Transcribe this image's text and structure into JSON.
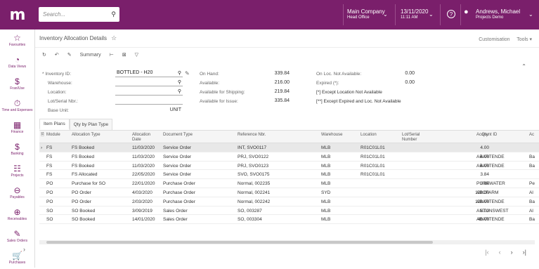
{
  "topbar": {
    "logo": "m",
    "search_placeholder": "Search...",
    "company": "Main Company",
    "branch": "Head Office",
    "date": "13/11/2020",
    "time": "11:11 AM",
    "help": "?",
    "user_name": "Andrews, Michael",
    "user_sub": "Projects Demo"
  },
  "sidebar": {
    "items": [
      {
        "icon": "☆",
        "label": "Favourites"
      },
      {
        "icon": "◔",
        "label": "Data Views"
      },
      {
        "icon": "$",
        "label": "Fran/Use"
      },
      {
        "icon": "⏱",
        "label": "Time and Expenses"
      },
      {
        "icon": "▦",
        "label": "Finance"
      },
      {
        "icon": "$",
        "label": "Banking"
      },
      {
        "icon": "☷",
        "label": "Projects"
      },
      {
        "icon": "⊖",
        "label": "Payables"
      },
      {
        "icon": "⊕",
        "label": "Receivables"
      },
      {
        "icon": "✎",
        "label": "Sales Orders"
      },
      {
        "icon": "🛒",
        "label": "Purchases"
      }
    ],
    "collapse": "›"
  },
  "page": {
    "title": "Inventory Allocation Details",
    "customisation": "Customisation",
    "tools": "Tools ▾",
    "summary": "Summary"
  },
  "form": {
    "inventory_id_label": "* Inventory ID:",
    "inventory_id_value": "BOTTLED - H20",
    "warehouse_label": "Warehouse:",
    "location_label": "Location:",
    "lot_label": "Lot/Serial Nbr.:",
    "base_unit_label": "Base Unit:",
    "base_unit_value": "UNIT",
    "on_hand_label": "On Hand:",
    "on_hand_value": "339.84",
    "available_label": "Available:",
    "available_value": "216.00",
    "avail_ship_label": "Available for Shipping:",
    "avail_ship_value": "219.84",
    "avail_issue_label": "Available for Issue:",
    "avail_issue_value": "335.84",
    "on_loc_label": "On Loc. Not Available:",
    "on_loc_value": "0.00",
    "expired_label": "Expired (*):",
    "expired_value": "0.00",
    "note1": "[*] Except Location Not Available",
    "note2": "[**] Except Expired and  Loc. Not Available"
  },
  "tabs": [
    "Item Plans",
    "Qty by Plan Type"
  ],
  "grid": {
    "headers": [
      "Module",
      "Allocation Type",
      "Allocation Date",
      "Document Type",
      "Reference Nbr.",
      "Warehouse",
      "Location",
      "Lot/Serial Number",
      "Qty.",
      "Account ID",
      "Ac"
    ],
    "rows": [
      [
        "FS",
        "FS Booked",
        "11/03/2020",
        "Service Order",
        "INT, SVO0117",
        "MLB",
        "R01C01L01",
        "",
        "4.00",
        "",
        ""
      ],
      [
        "FS",
        "FS Booked",
        "11/03/2020",
        "Service Order",
        "PRJ, SVO0122",
        "MLB",
        "R01C01L01",
        "",
        "4.00",
        "ABARTENDE",
        "Ba"
      ],
      [
        "FS",
        "FS Booked",
        "11/03/2020",
        "Service Order",
        "PRJ, SVO0123",
        "MLB",
        "R01C01L01",
        "",
        "4.00",
        "ABARTENDE",
        "Ba"
      ],
      [
        "FS",
        "FS Allocated",
        "22/05/2020",
        "Service Order",
        "SVO, SVO0175",
        "MLB",
        "R01C01L01",
        "",
        "3.84",
        "",
        ""
      ],
      [
        "PO",
        "Purchase for SO",
        "22/01/2020",
        "Purchase Order",
        "Normal, 002235",
        "MLB",
        "",
        "",
        "3.84",
        "PUREWATER",
        "Pe"
      ],
      [
        "PO",
        "PO Order",
        "4/03/2020",
        "Purchase Order",
        "Normal, 002241",
        "SYD",
        "",
        "",
        "128.00",
        "ABCFARM",
        "Al"
      ],
      [
        "PO",
        "PO Order",
        "2/03/2020",
        "Purchase Order",
        "Normal, 002242",
        "MLB",
        "",
        "",
        "128.00",
        "ABARTENDE",
        "Ba"
      ],
      [
        "SO",
        "SO Booked",
        "3/09/2019",
        "Sales Order",
        "SO, 003287",
        "MLB",
        "",
        "",
        "8.00",
        "ANTUNSWEST",
        "Al"
      ],
      [
        "SO",
        "SO Booked",
        "14/01/2020",
        "Sales Order",
        "SO, 003304",
        "MLB",
        "",
        "",
        "40.00",
        "ABARTENDE",
        "Ba"
      ]
    ]
  },
  "pager": [
    "|‹",
    "‹",
    "›",
    "›|"
  ]
}
